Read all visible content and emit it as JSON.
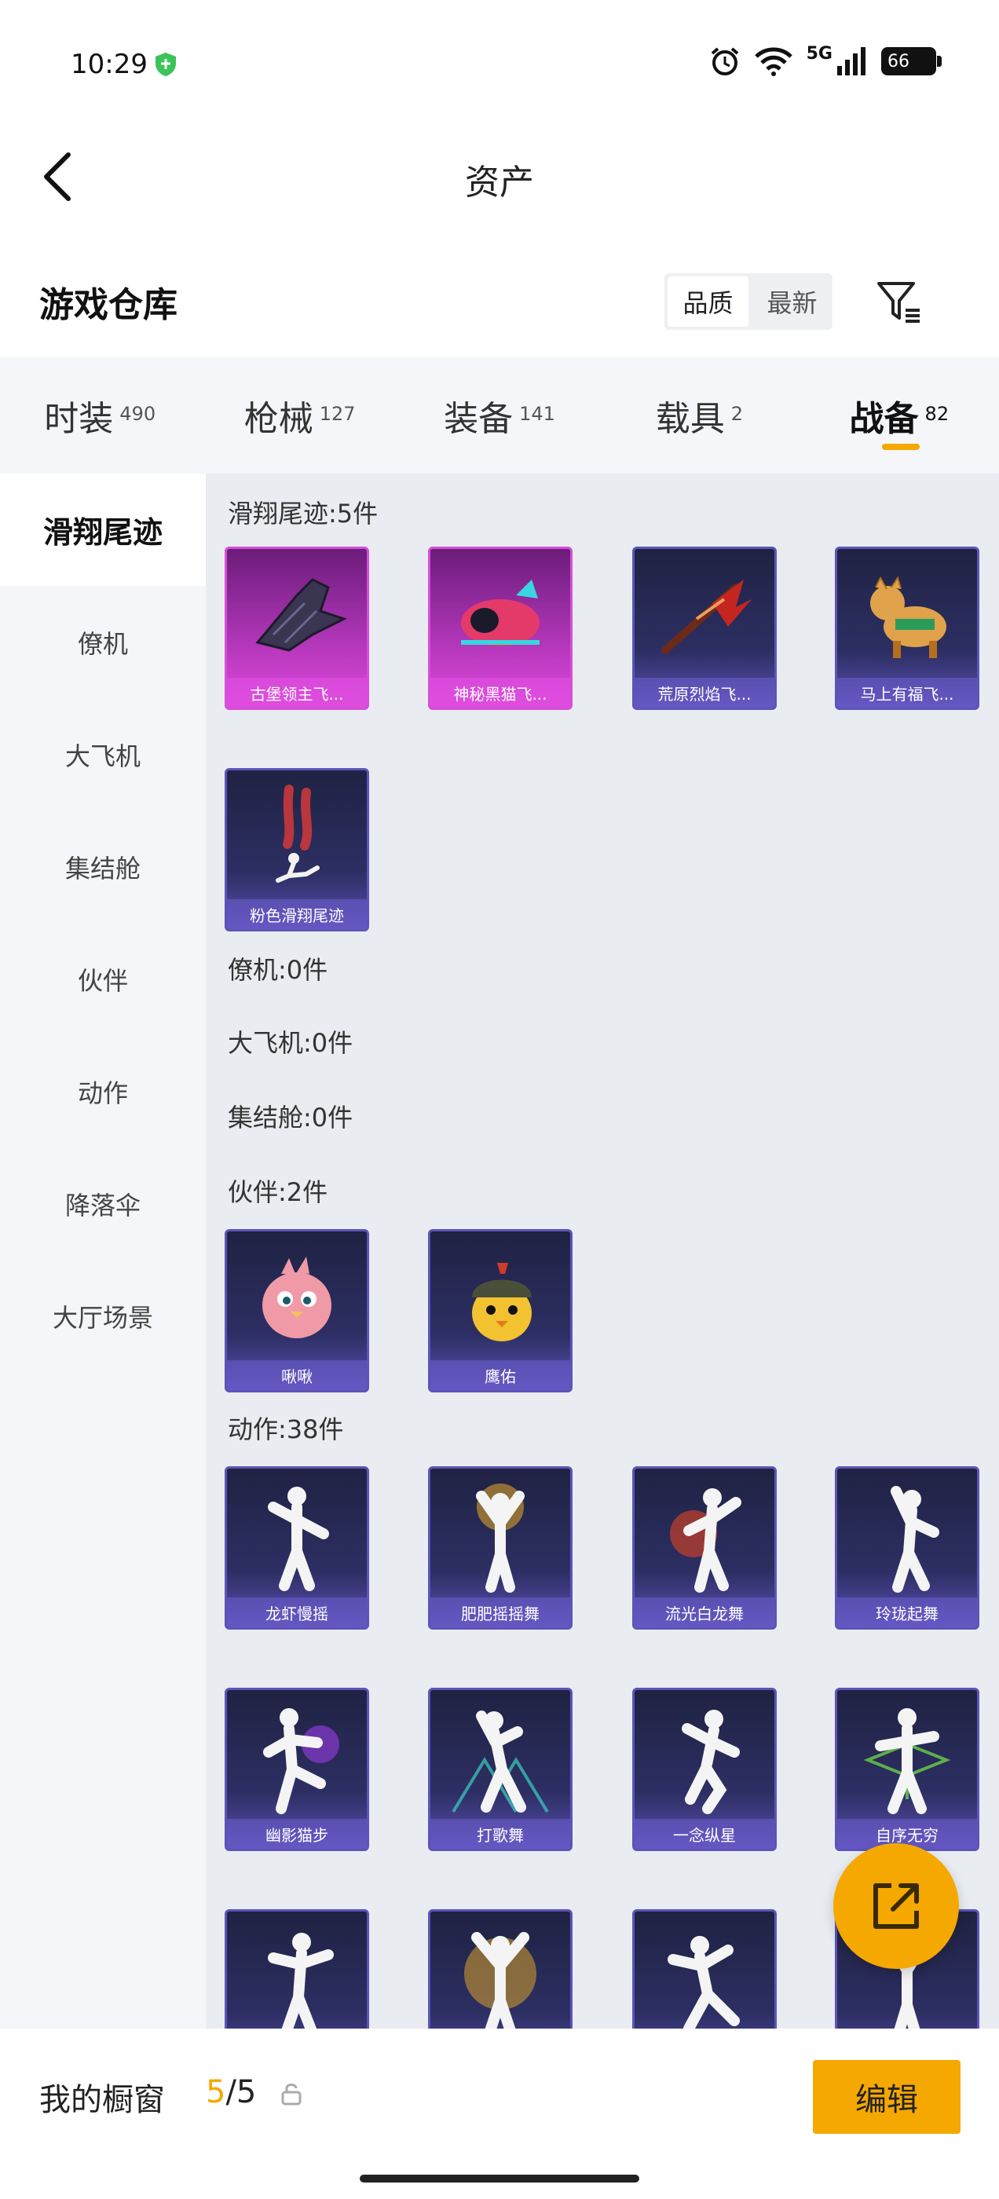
{
  "status_bar": {
    "time": "10:29",
    "network": "5G",
    "battery": "66"
  },
  "header": {
    "title": "资产"
  },
  "warehouse": {
    "title": "游戏仓库",
    "sort_options": [
      "品质",
      "最新"
    ]
  },
  "tabs": [
    {
      "label": "时装",
      "count": "490"
    },
    {
      "label": "枪械",
      "count": "127"
    },
    {
      "label": "装备",
      "count": "141"
    },
    {
      "label": "载具",
      "count": "2"
    },
    {
      "label": "战备",
      "count": "82",
      "active": true
    }
  ],
  "side_nav": [
    {
      "label": "滑翔尾迹",
      "active": true
    },
    {
      "label": "僚机"
    },
    {
      "label": "大飞机"
    },
    {
      "label": "集结舱"
    },
    {
      "label": "伙伴"
    },
    {
      "label": "动作"
    },
    {
      "label": "降落伞"
    },
    {
      "label": "大厅场景"
    }
  ],
  "sections": {
    "glide": {
      "title": "滑翔尾迹:5件",
      "items": [
        {
          "label": "古堡领主飞...",
          "rarity": "epic",
          "icon": "bat-wing-glider-icon"
        },
        {
          "label": "神秘黑猫飞...",
          "rarity": "epic",
          "icon": "cat-plane-glider-icon"
        },
        {
          "label": "荒原烈焰飞...",
          "rarity": "rare",
          "icon": "flame-glider-icon"
        },
        {
          "label": "马上有福飞...",
          "rarity": "rare",
          "icon": "horse-glider-icon"
        },
        {
          "label": "粉色滑翔尾迹",
          "rarity": "rare",
          "icon": "pink-smoke-trail-icon"
        }
      ]
    },
    "wingman": {
      "title": "僚机:0件"
    },
    "plane": {
      "title": "大飞机:0件"
    },
    "pod": {
      "title": "集结舱:0件"
    },
    "partner": {
      "title": "伙伴:2件",
      "items": [
        {
          "label": "啾啾",
          "rarity": "rare",
          "icon": "pink-bird-icon"
        },
        {
          "label": "鹰佑",
          "rarity": "rare",
          "icon": "helmet-chick-icon"
        }
      ]
    },
    "emote": {
      "title": "动作:38件",
      "items": [
        {
          "label": "龙虾慢摇",
          "rarity": "rare",
          "icon": "dance-pose-icon"
        },
        {
          "label": "肥肥摇摇舞",
          "rarity": "rare",
          "icon": "dance-pose-icon"
        },
        {
          "label": "流光白龙舞",
          "rarity": "rare",
          "icon": "dance-pose-icon"
        },
        {
          "label": "玲珑起舞",
          "rarity": "rare",
          "icon": "dance-pose-icon"
        },
        {
          "label": "幽影猫步",
          "rarity": "rare",
          "icon": "dance-pose-icon"
        },
        {
          "label": "打歌舞",
          "rarity": "rare",
          "icon": "dance-pose-icon"
        },
        {
          "label": "一念纵星",
          "rarity": "rare",
          "icon": "dance-pose-icon"
        },
        {
          "label": "自序无穷",
          "rarity": "rare",
          "icon": "dance-pose-icon"
        },
        {
          "label": "",
          "rarity": "rare",
          "icon": "dance-pose-icon"
        },
        {
          "label": "",
          "rarity": "rare",
          "icon": "dance-pose-icon"
        },
        {
          "label": "",
          "rarity": "rare",
          "icon": "dance-pose-icon"
        },
        {
          "label": "",
          "rarity": "rare",
          "icon": "dance-pose-icon"
        }
      ]
    }
  },
  "fab": {
    "icon": "share-external-icon"
  },
  "bottom_bar": {
    "showcase_label": "我的橱窗",
    "showcase_current": "5",
    "showcase_total": "/5",
    "edit_label": "编辑"
  },
  "colors": {
    "accent": "#f5a800",
    "epic": "#c13cc6",
    "rare": "#2d2f64"
  }
}
